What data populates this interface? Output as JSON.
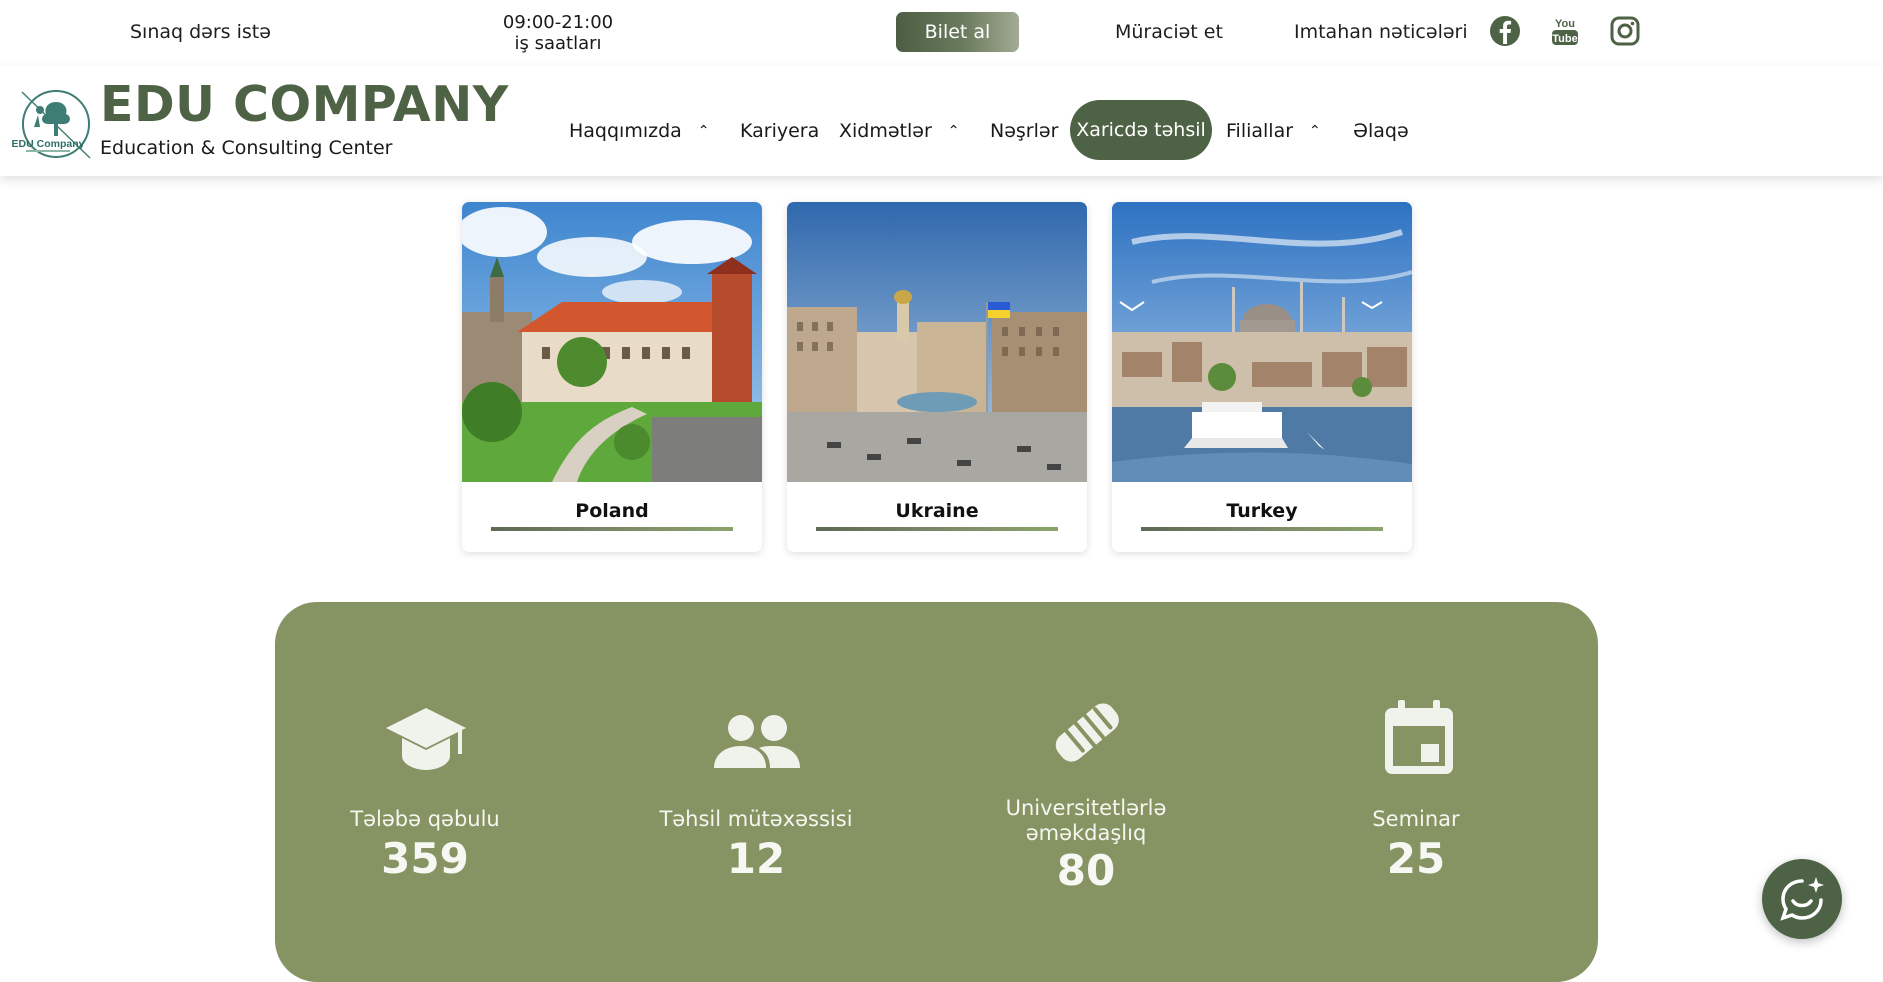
{
  "topbar": {
    "trial_lesson": "Sınaq dərs istə",
    "hours_time": "09:00-21:00",
    "hours_label": "iş saatları",
    "ticket_button": "Bilet al",
    "apply": "Müraciət et",
    "exam_results": "Imtahan nəticələri",
    "socials": [
      "facebook-icon",
      "youtube-icon",
      "instagram-icon"
    ]
  },
  "brand": {
    "name": "EDU COMPANY",
    "subtitle": "Education & Consulting Center",
    "badge_text": "EDU Company"
  },
  "nav": {
    "items": [
      {
        "label": "Haqqımızda",
        "has_dropdown": true
      },
      {
        "label": "Kariyera",
        "has_dropdown": false
      },
      {
        "label": "Xidmətlər",
        "has_dropdown": true
      },
      {
        "label": "Nəşrlər",
        "has_dropdown": false
      },
      {
        "label": "Xaricdə təhsil",
        "active": true
      },
      {
        "label": "Filiallar",
        "has_dropdown": true
      },
      {
        "label": "Əlaqə",
        "has_dropdown": false
      }
    ]
  },
  "countries": [
    {
      "name": "Poland"
    },
    {
      "name": "Ukraine"
    },
    {
      "name": "Turkey"
    }
  ],
  "stats": [
    {
      "icon": "graduation-cap-icon",
      "label": "Tələbə qəbulu",
      "value": "359"
    },
    {
      "icon": "people-icon",
      "label": "Təhsil mütəxəssisi",
      "value": "12"
    },
    {
      "icon": "handshake-icon",
      "label_line1": "Universitetlərlə",
      "label_line2": "əməkdaşlıq",
      "value": "80"
    },
    {
      "icon": "calendar-icon",
      "label": "Seminar",
      "value": "25"
    }
  ],
  "colors": {
    "brand_green": "#4e6245",
    "stats_bg": "#869463",
    "accent_line": "#8ca36a"
  }
}
